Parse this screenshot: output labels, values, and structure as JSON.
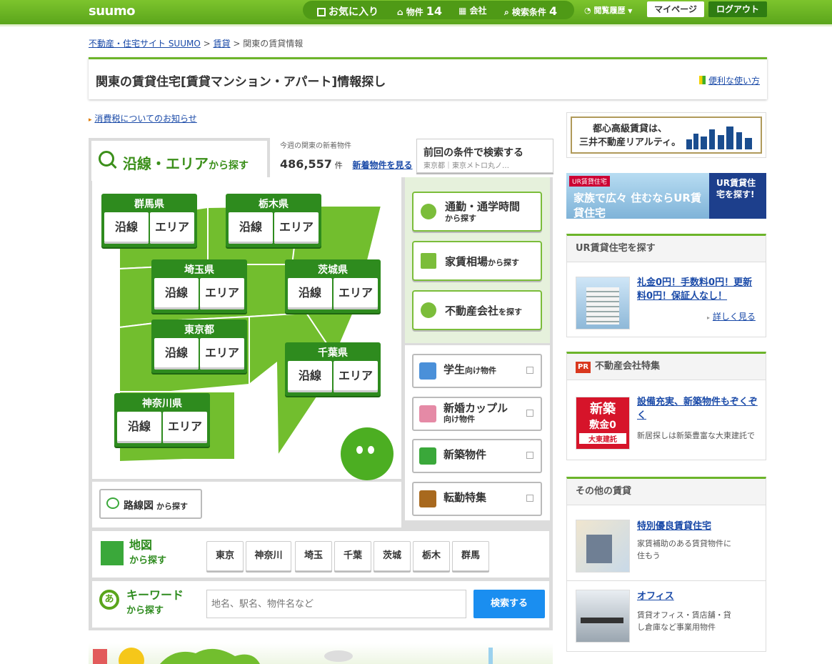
{
  "header": {
    "logo": "suumo",
    "favorites": "お気に入り",
    "property_label": "物件",
    "property_count": "14",
    "company_label": "会社",
    "conditions_label": "検索条件",
    "conditions_count": "4",
    "history": "閲覧履歴",
    "mypage": "マイページ",
    "logout": "ログアウト"
  },
  "breadcrumb": {
    "items": [
      "不動産・住宅サイト SUUMO",
      "賃貸"
    ],
    "separator": ">",
    "current": "関東の賃貸情報"
  },
  "title": "関東の賃貸住宅[賃貸マンション・アパート]情報探し",
  "howto": "便利な使い方",
  "tax_notice": "消費税についてのお知らせ",
  "tab": {
    "main": "沿線・エリア",
    "suffix": "から探す"
  },
  "new_listings": {
    "caption": "今週の関東の新着物件",
    "count": "486,557",
    "unit": "件",
    "link": "新着物件を見る"
  },
  "last_search": {
    "title": "前回の条件で検索する",
    "sub": "東京都｜東京メトロ丸ノ…"
  },
  "line_label": "沿線",
  "area_label": "エリア",
  "prefectures": [
    "群馬県",
    "栃木県",
    "埼玉県",
    "茨城県",
    "東京都",
    "千葉県",
    "神奈川県"
  ],
  "right_buttons": [
    {
      "main": "通勤・通学時間",
      "sub": "から探す"
    },
    {
      "main": "家賃相場",
      "sub": "から探す"
    },
    {
      "main": "不動産会社",
      "sub": "を探す"
    }
  ],
  "special_buttons": [
    {
      "main": "学生",
      "sub": "向け物件"
    },
    {
      "main": "新婚カップル",
      "sub": "向け物件"
    },
    {
      "main": "新築物件",
      "sub": ""
    },
    {
      "main": "転勤特集",
      "sub": ""
    }
  ],
  "route_map": {
    "main": "路線図",
    "sub": "から探す"
  },
  "map_search": {
    "main": "地図",
    "sub": "から探す",
    "cities": [
      "東京",
      "神奈川",
      "埼玉",
      "千葉",
      "茨城",
      "栃木",
      "群馬"
    ]
  },
  "keyword": {
    "main": "キーワード",
    "sub": "から探す",
    "placeholder": "地名、駅名、物件名など",
    "button": "検索する"
  },
  "sidebar": {
    "ad1": {
      "line1": "都心高級賃貸は、",
      "line2": "三井不動産リアルティ。"
    },
    "ad2": {
      "badge": "UR賃貸住宅",
      "text": "家族で広々 住むならUR賃貸住宅",
      "right": "UR賃貸住宅を探す!"
    },
    "ur": {
      "header": "UR賃貸住宅を探す",
      "link": "礼金0円！手数料0円！更新料0円！保証人なし！",
      "more": "詳しく見る"
    },
    "pr": {
      "badge": "PR",
      "header": "不動産会社特集",
      "thumb_big": "新築",
      "thumb_mid": "敷金0",
      "thumb_brand": "大東建託",
      "link": "設備充実、新築物件もぞくぞく",
      "desc": "新居探しは新築豊富な大東建託で"
    },
    "other": {
      "header": "その他の賃貸",
      "items": [
        {
          "link": "特別優良賃貸住宅",
          "desc": "家賃補助のある賃貸物件に住もう"
        },
        {
          "link": "オフィス",
          "desc": "賃貸オフィス・賃店舗・貸し倉庫など事業用物件"
        }
      ]
    }
  },
  "colors": {
    "brand_green": "#6cb42a",
    "dark_green": "#2e8b1e",
    "map_green": "#72be2e",
    "link_blue": "#1a4aa8",
    "search_blue": "#1a8ef0"
  }
}
